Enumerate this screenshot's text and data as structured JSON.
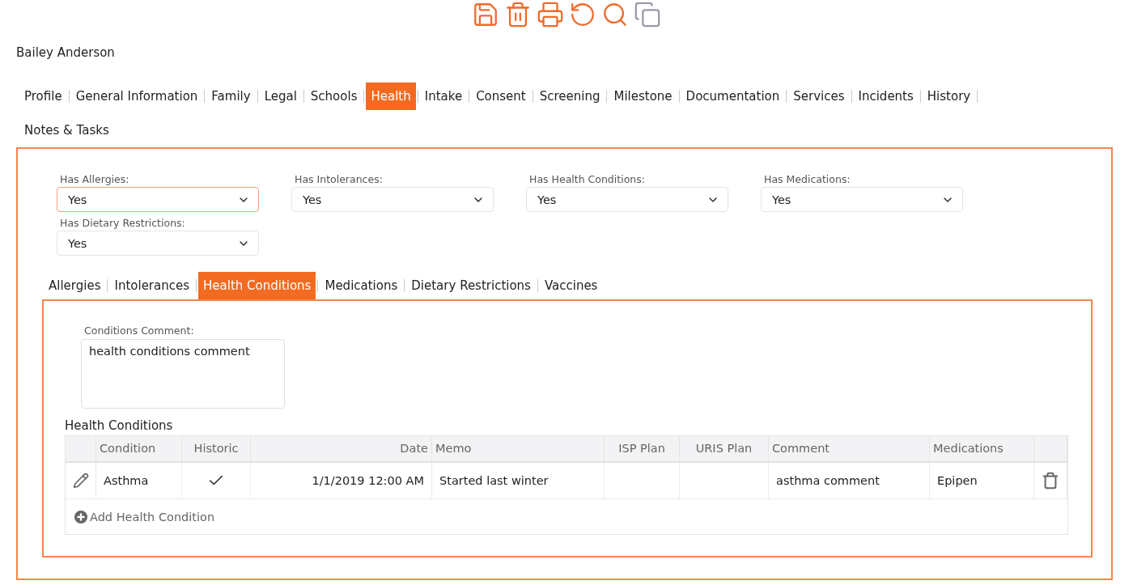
{
  "toolbar": [
    {
      "kind": "save",
      "disabled": false
    },
    {
      "kind": "delete",
      "disabled": false
    },
    {
      "kind": "print",
      "disabled": false
    },
    {
      "kind": "undo",
      "disabled": false
    },
    {
      "kind": "search",
      "disabled": false
    },
    {
      "kind": "copy",
      "disabled": true
    }
  ],
  "person_name": "Bailey Anderson",
  "tabs": [
    {
      "label": "Profile",
      "selected": false
    },
    {
      "label": "General Information",
      "selected": false
    },
    {
      "label": "Family",
      "selected": false
    },
    {
      "label": "Legal",
      "selected": false
    },
    {
      "label": "Schools",
      "selected": false
    },
    {
      "label": "Health",
      "selected": true
    },
    {
      "label": "Intake",
      "selected": false
    },
    {
      "label": "Consent",
      "selected": false
    },
    {
      "label": "Screening",
      "selected": false
    },
    {
      "label": "Milestone",
      "selected": false
    },
    {
      "label": "Documentation",
      "selected": false
    },
    {
      "label": "Services",
      "selected": false
    },
    {
      "label": "Incidents",
      "selected": false
    },
    {
      "label": "History",
      "selected": false
    },
    {
      "label": "Notes & Tasks",
      "selected": false
    }
  ],
  "fields": [
    {
      "label": "Has Allergies:",
      "value": "Yes",
      "focused": true
    },
    {
      "label": "Has Intolerances:",
      "value": "Yes",
      "focused": false
    },
    {
      "label": "Has Health Conditions:",
      "value": "Yes",
      "focused": false
    },
    {
      "label": "Has Medications:",
      "value": "Yes",
      "focused": false
    },
    {
      "label": "Has Dietary Restrictions:",
      "value": "Yes",
      "focused": false
    }
  ],
  "sub_tabs": [
    {
      "label": "Allergies",
      "selected": false
    },
    {
      "label": "Intolerances",
      "selected": false
    },
    {
      "label": "Health Conditions",
      "selected": true
    },
    {
      "label": "Medications",
      "selected": false
    },
    {
      "label": "Dietary Restrictions",
      "selected": false
    },
    {
      "label": "Vaccines",
      "selected": false
    }
  ],
  "comment": {
    "label": "Conditions Comment:",
    "value": "health conditions comment"
  },
  "table": {
    "title": "Health Conditions",
    "columns": [
      "Condition",
      "Historic",
      "Date",
      "Memo",
      "ISP Plan",
      "URIS Plan",
      "Comment",
      "Medications"
    ],
    "rows": [
      {
        "condition": "Asthma",
        "historic": true,
        "date": "1/1/2019 12:00 AM",
        "memo": "Started last winter",
        "isp_plan": "",
        "uris_plan": "",
        "comment": "asthma comment",
        "medications": "Epipen"
      }
    ],
    "add_label": "Add Health Condition"
  }
}
